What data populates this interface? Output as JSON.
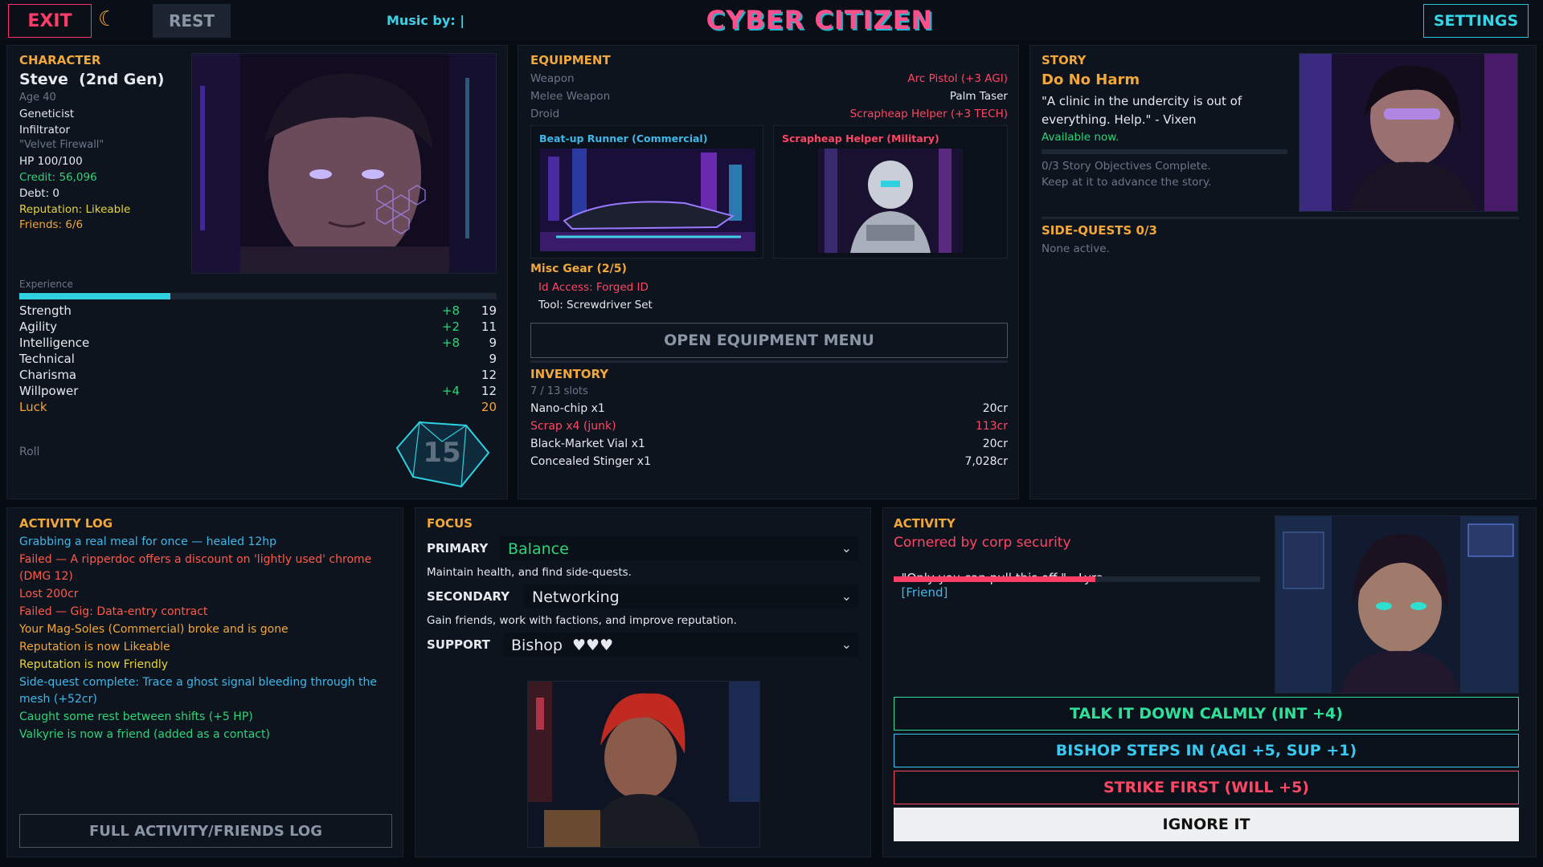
{
  "topbar": {
    "exit_label": "EXIT",
    "moon_icon": "☾",
    "rest_label": "REST",
    "music_label": "Music by: |",
    "title": "CYBER CITIZEN",
    "settings_label": "SETTINGS"
  },
  "character": {
    "header": "CHARACTER",
    "name": "Steve  (2nd Gen)",
    "age": "Age 40",
    "class1": "Geneticist",
    "class2": "Infiltrator",
    "alias": "\"Velvet Firewall\"",
    "hp": "HP 100/100",
    "credit": "Credit: 56,096",
    "debt": "Debt: 0",
    "reputation": "Reputation: Likeable",
    "friends": "Friends: 6/6",
    "experience_label": "Experience",
    "experience_fraction": 0.316,
    "stats": [
      {
        "name": "Strength",
        "bonus": "+8",
        "value": "19"
      },
      {
        "name": "Agility",
        "bonus": "+2",
        "value": "11"
      },
      {
        "name": "Intelligence",
        "bonus": "+8",
        "value": "9"
      },
      {
        "name": "Technical",
        "bonus": "",
        "value": "9"
      },
      {
        "name": "Charisma",
        "bonus": "",
        "value": "12"
      },
      {
        "name": "Willpower",
        "bonus": "+4",
        "value": "12"
      },
      {
        "name": "Luck",
        "bonus": "",
        "value": "20"
      }
    ],
    "roll_label": "Roll",
    "die_value": "15"
  },
  "equipment": {
    "header": "EQUIPMENT",
    "weapon_label": "Weapon",
    "weapon_value": "Arc Pistol  (+3 AGI)",
    "melee_label": "Melee Weapon",
    "melee_value": "Palm Taser",
    "droid_label": "Droid",
    "droid_value": "Scrapheap Helper  (+3 TECH)",
    "vehicle_card": "Beat-up Runner (Commercial)",
    "droid_card": "Scrapheap Helper (Military)",
    "misc_header": "Misc Gear (2/5)",
    "misc_items": [
      "Id Access: Forged ID",
      "Tool: Screwdriver Set"
    ],
    "open_menu_label": "OPEN EQUIPMENT MENU",
    "inventory_header": "INVENTORY",
    "inventory_slots": "7 / 13 slots",
    "inventory": [
      {
        "name": "Nano-chip x1",
        "price": "20cr"
      },
      {
        "name": "Scrap x4 (junk)",
        "price": "113cr"
      },
      {
        "name": "Black-Market Vial x1",
        "price": "20cr"
      },
      {
        "name": "Concealed Stinger x1",
        "price": "7,028cr"
      }
    ]
  },
  "story": {
    "header": "STORY",
    "title": "Do No Harm",
    "quote": "\"A clinic in the undercity is out of everything. Help.\" - Vixen",
    "available": "Available now.",
    "objectives": "0/3 Story Objectives Complete.",
    "advance": "Keep at it to advance the story.",
    "side_header": "SIDE-QUESTS 0/3",
    "side_none": "None active."
  },
  "activity_log": {
    "header": "ACTIVITY LOG",
    "items": [
      {
        "text": "Grabbing a real meal for once — healed 12hp",
        "color": "#3fb8ea"
      },
      {
        "text": "Failed — A ripperdoc offers a discount on 'lightly used' chrome  (DMG 12)",
        "color": "#ff5a4a"
      },
      {
        "text": "Lost 200cr",
        "color": "#ff5a4a"
      },
      {
        "text": "Failed — Gig: Data-entry contract",
        "color": "#ff5a4a"
      },
      {
        "text": "Your Mag-Soles (Commercial) broke and is gone",
        "color": "#f2a73a"
      },
      {
        "text": "Reputation is now Likeable",
        "color": "#f2a73a"
      },
      {
        "text": "Reputation is now Friendly",
        "color": "#e6d23a"
      },
      {
        "text": "Side-quest complete: Trace a ghost signal bleeding through the mesh (+52cr)",
        "color": "#3fb8ea"
      },
      {
        "text": "Caught some rest between shifts (+5 HP)",
        "color": "#2fd37a"
      },
      {
        "text": "Valkyrie is now a friend (added as a contact)",
        "color": "#2fd37a"
      }
    ],
    "full_log_label": "FULL ACTIVITY/FRIENDS LOG"
  },
  "focus": {
    "header": "FOCUS",
    "primary_label": "PRIMARY",
    "primary_value": "Balance",
    "primary_desc": "Maintain health, and find side-quests.",
    "secondary_label": "SECONDARY",
    "secondary_value": "Networking",
    "secondary_desc": "Gain friends, work with factions, and improve reputation.",
    "support_label": "SUPPORT",
    "support_value": "Bishop  ♥♥♥",
    "chevron": "⌄"
  },
  "activity": {
    "header": "ACTIVITY",
    "title": "Cornered by corp security",
    "quote": "\"Only you can pull this off.\" - Lyra",
    "tag": "[Friend]",
    "progress_fraction": 0.55,
    "choices": [
      {
        "label": "TALK IT DOWN CALMLY (INT +4)",
        "color": "#2fe09a"
      },
      {
        "label": "BISHOP STEPS IN (AGI +5, SUP +1)",
        "color": "#38c8f0"
      },
      {
        "label": "STRIKE FIRST (WILL +5)",
        "color": "#ff4664"
      },
      {
        "label": "IGNORE IT",
        "color": "#111111"
      }
    ]
  }
}
